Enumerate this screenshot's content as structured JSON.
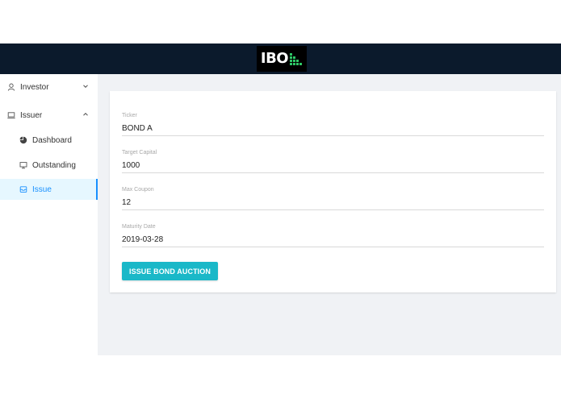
{
  "header": {
    "logo_text": "IBO",
    "logo_mark_icon": "bar-steps-logo-mark",
    "logo_mark_color": "#2ec866",
    "background": "#0b1a2c"
  },
  "sidebar": {
    "items": [
      {
        "label": "Investor",
        "icon": "user-icon",
        "expanded": false
      },
      {
        "label": "Issuer",
        "icon": "laptop-icon",
        "expanded": true
      },
      {
        "label": "Dashboard",
        "icon": "pie-chart-icon"
      },
      {
        "label": "Outstanding",
        "icon": "desktop-icon"
      },
      {
        "label": "Issue",
        "icon": "inbox-icon",
        "selected": true
      }
    ],
    "selected_color": "#1890ff"
  },
  "form": {
    "fields": [
      {
        "label": "Ticker",
        "value": "BOND A"
      },
      {
        "label": "Target Capital",
        "value": "1000"
      },
      {
        "label": "Max Coupon",
        "value": "12"
      },
      {
        "label": "Maturity Date",
        "value": "2019-03-28"
      }
    ],
    "submit_label": "ISSUE BOND AUCTION",
    "submit_color": "#1ab8c8"
  }
}
